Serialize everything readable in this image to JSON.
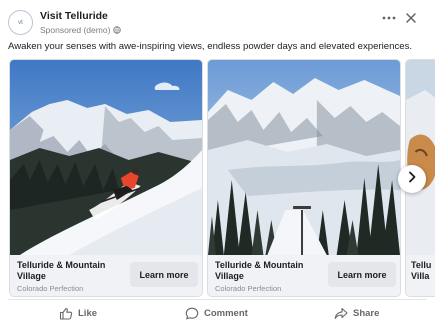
{
  "post": {
    "page_name": "Visit Telluride",
    "sponsored": "Sponsored (demo)",
    "caption": "Awaken your senses with awe-inspiring views, endless powder days and elevated experiences.",
    "avatar_text": "vt",
    "icons": {
      "avatar": "page-logo",
      "privacy": "globe-icon",
      "more": "more-options-icon",
      "close": "close-icon",
      "next": "chevron-right-icon"
    }
  },
  "carousel": {
    "cards": [
      {
        "title": "Telluride & Mountain Village",
        "subtitle": "Colorado Perfection",
        "cta": "Learn more"
      },
      {
        "title": "Telluride & Mountain Village",
        "subtitle": "Colorado Perfection",
        "cta": "Learn more"
      },
      {
        "title": "Tellu Villa",
        "subtitle": "",
        "cta": ""
      }
    ]
  },
  "actions": {
    "like": "Like",
    "comment": "Comment",
    "share": "Share"
  },
  "colors": {
    "sky": "#5b8fd3",
    "snow": "#f3f6fa",
    "forest": "#2f3b34",
    "skier_jacket": "#e8462a",
    "card_footer": "#f0f2f5"
  }
}
